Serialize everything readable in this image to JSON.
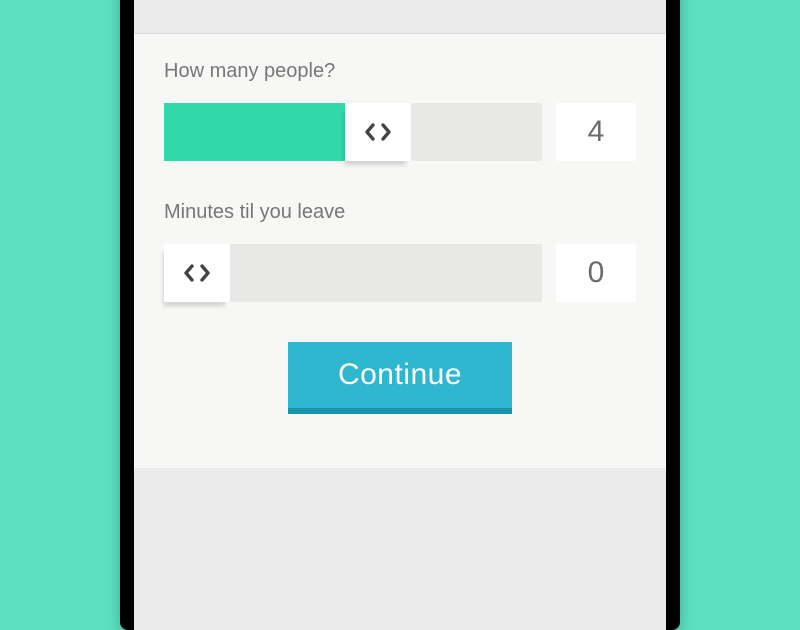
{
  "form": {
    "people": {
      "label": "How many people?",
      "value": "4"
    },
    "minutes": {
      "label": "Minutes til you leave",
      "value": "0"
    },
    "continue_label": "Continue"
  },
  "colors": {
    "accent_teal": "#31d8aa",
    "button_blue": "#2eb7cf"
  }
}
